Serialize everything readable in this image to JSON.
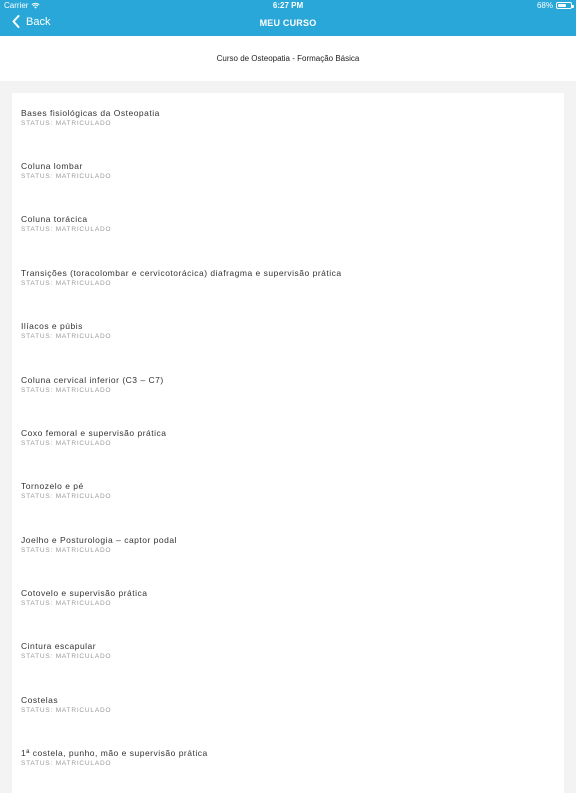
{
  "status_bar": {
    "carrier": "Carrier",
    "time": "6:27 PM",
    "battery": "68%",
    "battery_level": 0.68
  },
  "navbar": {
    "back_label": "Back",
    "title": "MEU CURSO"
  },
  "course": {
    "name": "Curso de Osteopatia - Formação Básica"
  },
  "modules": [
    {
      "title": "Bases fisiológicas da Osteopatia",
      "status": "STATUS: MATRICULADO"
    },
    {
      "title": "Coluna lombar",
      "status": "STATUS: MATRICULADO"
    },
    {
      "title": "Coluna torácica",
      "status": "STATUS: MATRICULADO"
    },
    {
      "title": "Transições (toracolombar e cervicotorácica) diafragma e supervisão prática",
      "status": "STATUS: MATRICULADO"
    },
    {
      "title": "Ilíacos e púbis",
      "status": "STATUS: MATRICULADO"
    },
    {
      "title": "Coluna cervical inferior (C3 – C7)",
      "status": "STATUS: MATRICULADO"
    },
    {
      "title": "Coxo femoral e supervisão prática",
      "status": "STATUS: MATRICULADO"
    },
    {
      "title": "Tornozelo e pé",
      "status": "STATUS: MATRICULADO"
    },
    {
      "title": "Joelho e Posturologia – captor podal",
      "status": "STATUS: MATRICULADO"
    },
    {
      "title": "Cotovelo e supervisão prática",
      "status": "STATUS: MATRICULADO"
    },
    {
      "title": "Cintura escapular",
      "status": "STATUS: MATRICULADO"
    },
    {
      "title": "Costelas",
      "status": "STATUS: MATRICULADO"
    },
    {
      "title": "1ª costela, punho, mão e supervisão prática",
      "status": "STATUS: MATRICULADO"
    }
  ],
  "colors": {
    "accent": "#29a7d8",
    "background": "#f3f3f3",
    "card": "#ffffff"
  }
}
